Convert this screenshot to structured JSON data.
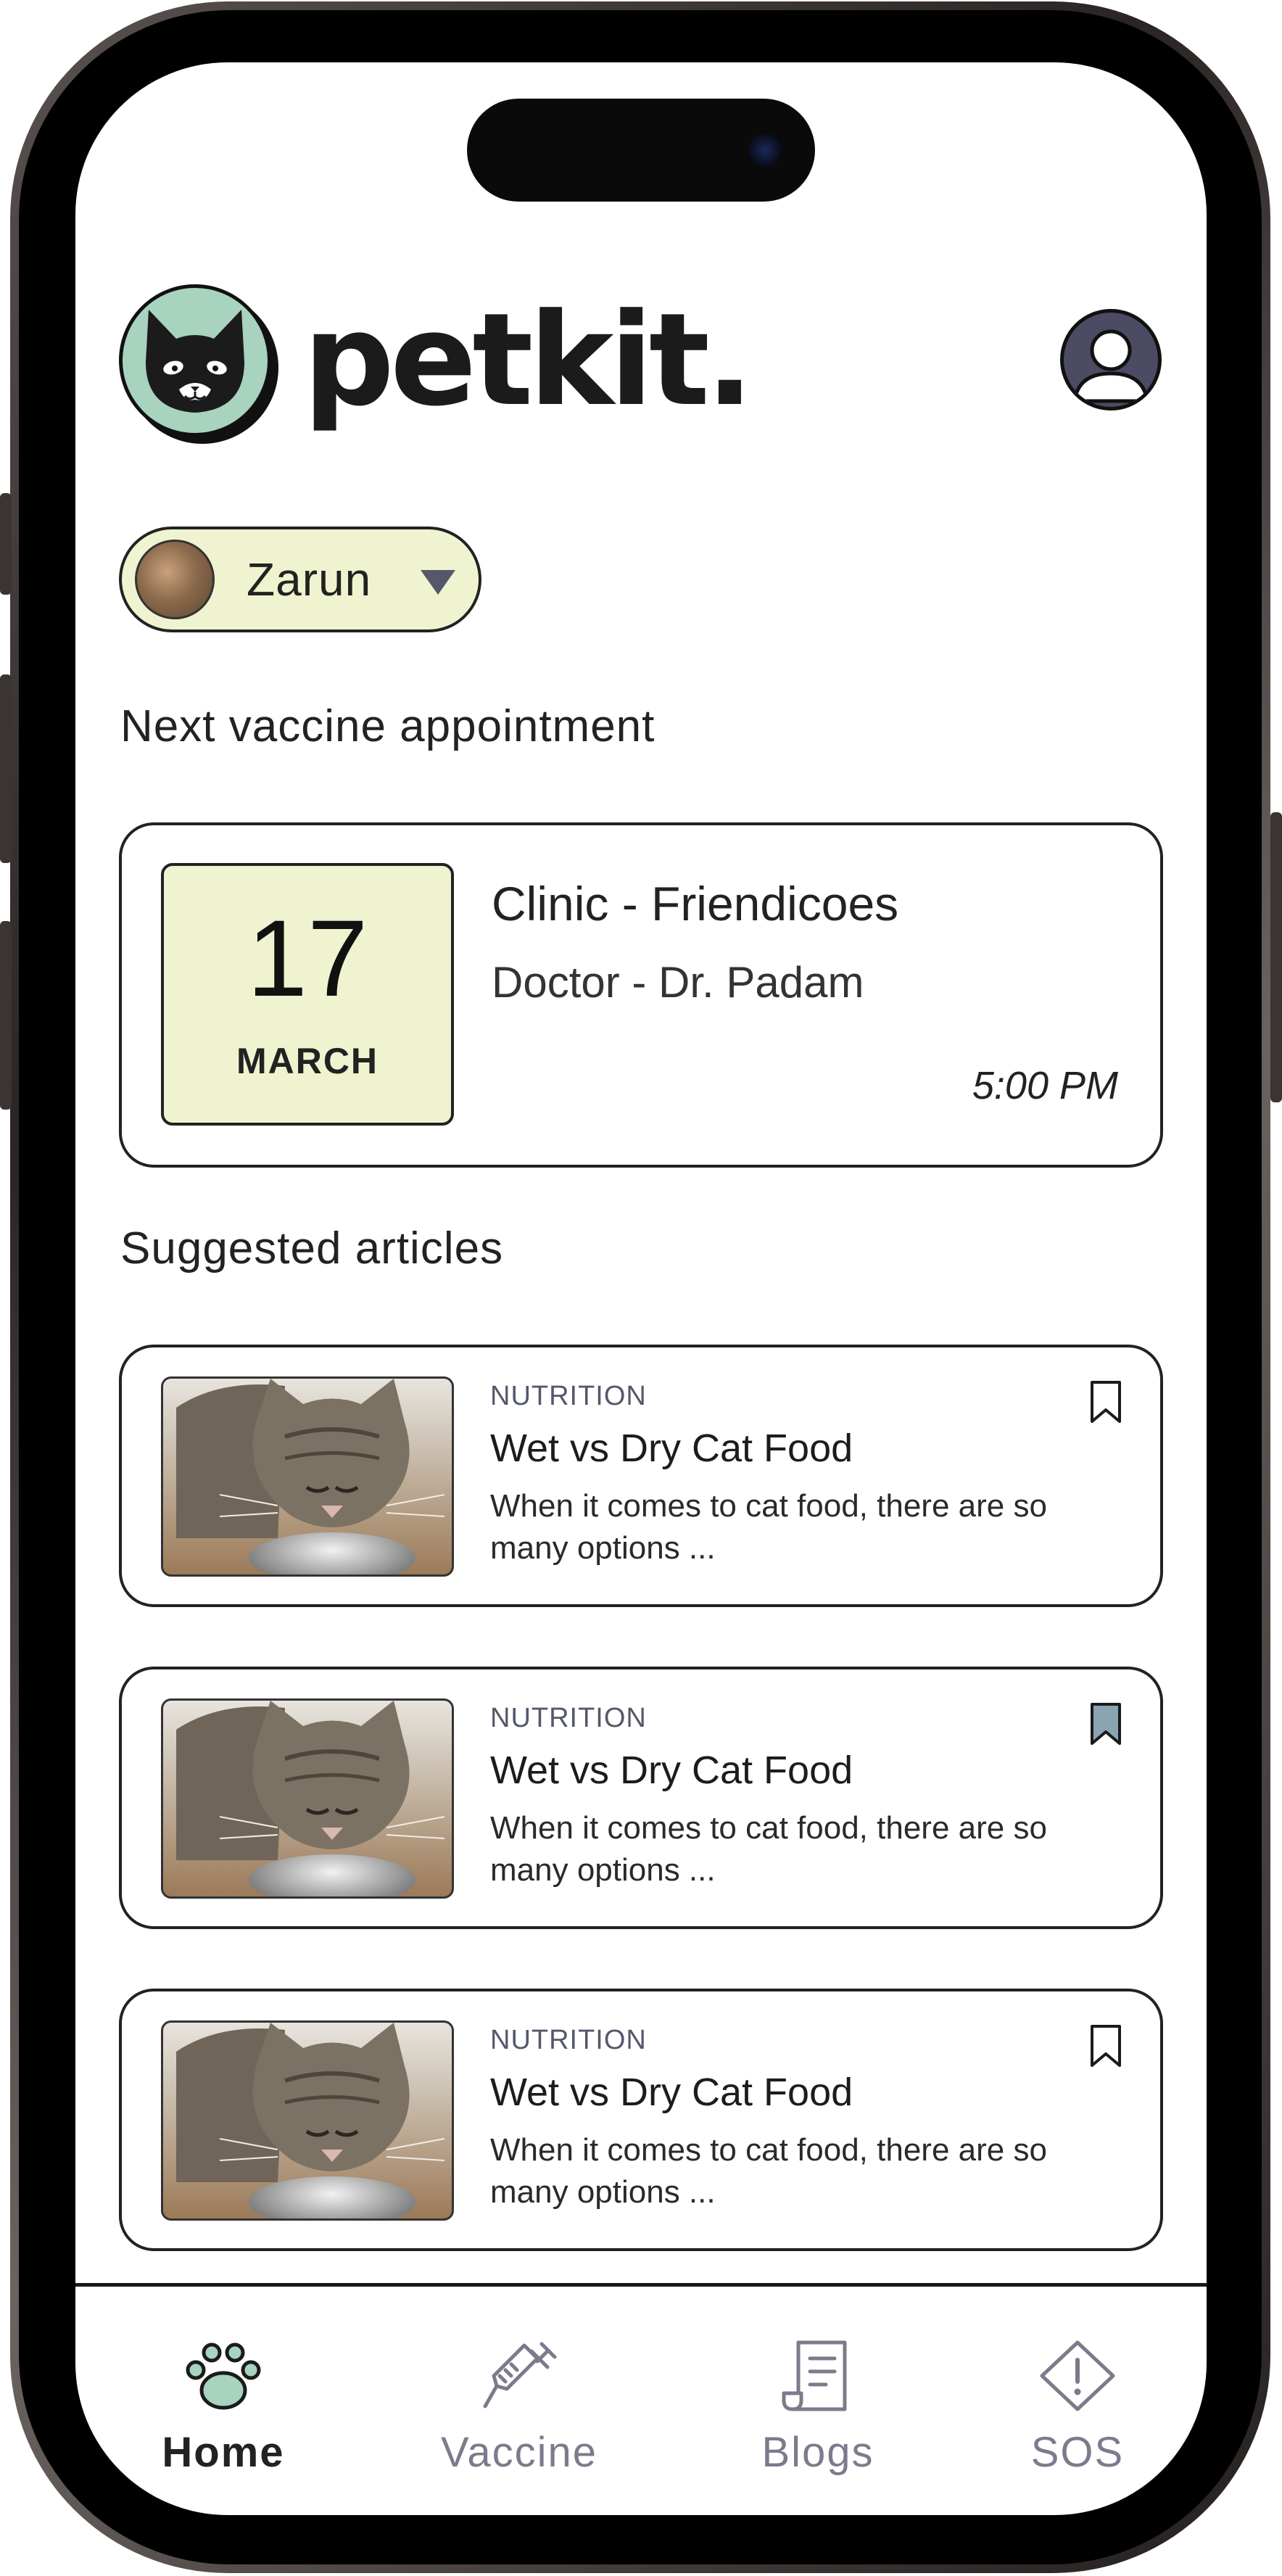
{
  "header": {
    "brand": "petkit.",
    "logo_icon": "cat-face-icon",
    "profile_icon": "user-profile-icon"
  },
  "pet_selector": {
    "name": "Zarun",
    "caret_icon": "caret-down-icon"
  },
  "appointment": {
    "section_title": "Next vaccine appointment",
    "day": "17",
    "month": "MARCH",
    "clinic": "Clinic - Friendicoes",
    "doctor": "Doctor - Dr. Padam",
    "time": "5:00 PM"
  },
  "articles": {
    "section_title": "Suggested articles",
    "items": [
      {
        "category": "NUTRITION",
        "title": "Wet vs Dry Cat Food",
        "excerpt": "When it comes to cat food, there are so many options ...",
        "bookmarked": false
      },
      {
        "category": "NUTRITION",
        "title": "Wet vs Dry Cat Food",
        "excerpt": "When it comes to cat food, there are so many options ...",
        "bookmarked": true
      },
      {
        "category": "NUTRITION",
        "title": "Wet vs Dry Cat Food",
        "excerpt": "When it comes to cat food, there are so many options ...",
        "bookmarked": false
      }
    ]
  },
  "bottom_nav": {
    "items": [
      {
        "label": "Home",
        "icon": "paw-icon",
        "active": true
      },
      {
        "label": "Vaccine",
        "icon": "syringe-icon",
        "active": false
      },
      {
        "label": "Blogs",
        "icon": "document-icon",
        "active": false
      },
      {
        "label": "SOS",
        "icon": "alert-diamond-icon",
        "active": false
      }
    ]
  },
  "colors": {
    "accent_cream": "#f0f3cf",
    "logo_mint": "#a8d3be",
    "bookmark_filled": "#8aa4b2",
    "nav_inactive": "#7b7b8c",
    "paw_green": "#a8d3be"
  }
}
